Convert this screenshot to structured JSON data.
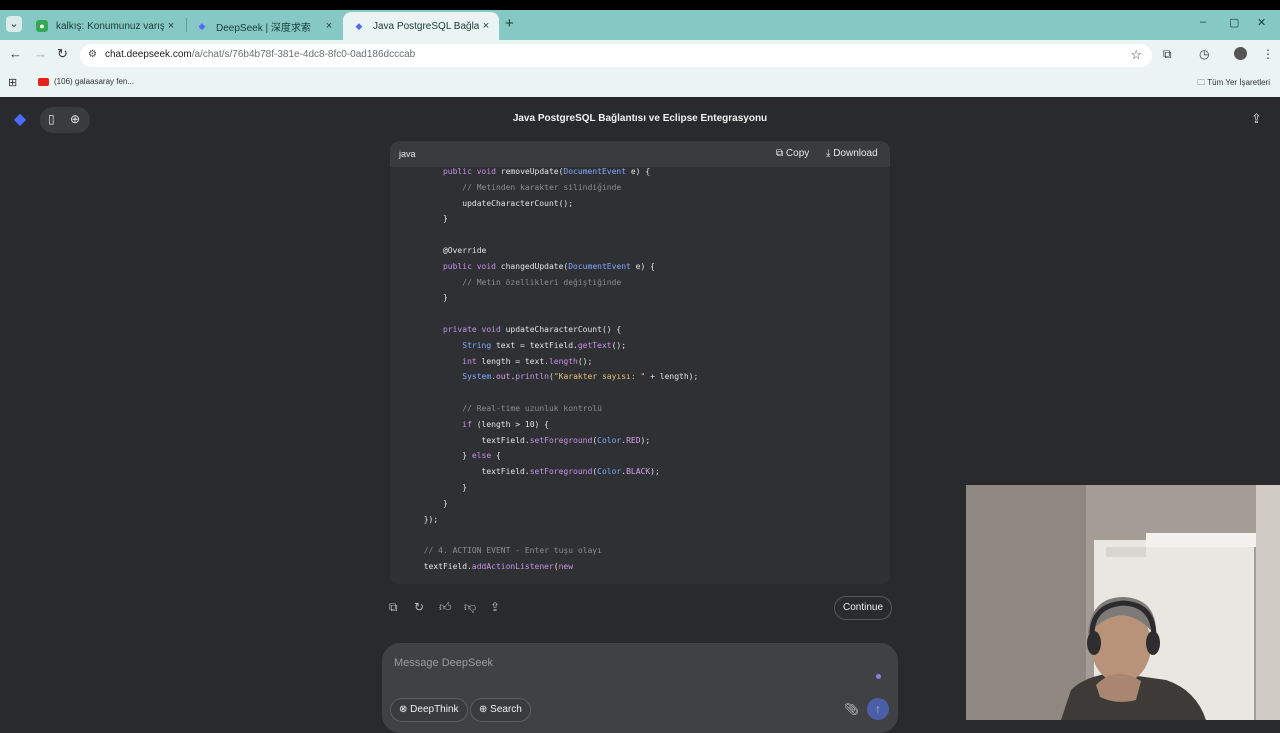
{
  "browser": {
    "tabs": [
      {
        "title": "kalkış: Konumunuz varış: Ayvan",
        "close": "×"
      },
      {
        "title": "DeepSeek | 深度求索",
        "close": "×"
      },
      {
        "title": "Java PostgreSQL Bağlantısı ve E",
        "close": "×"
      }
    ],
    "new_tab": "+",
    "url_host": "chat.deepseek.com",
    "url_path": "/a/chat/s/76b4b78f-381e-4dc8-8fc0-0ad186dcccab",
    "bookmarks": [
      {
        "label": "(106) galaasaray fen..."
      }
    ],
    "bookmarks_all": "Tüm Yer İşaretleri"
  },
  "app": {
    "chat_title": "Java PostgreSQL Bağlantısı ve Eclipse Entegrasyonu",
    "code_block": {
      "language": "java",
      "copy_label": "Copy",
      "download_label": "Download",
      "lines": [
        "        public void removeUpdate(DocumentEvent e) {",
        "            // Metinden karakter silindiğinde",
        "            updateCharacterCount();",
        "        }",
        "",
        "        @Override",
        "        public void changedUpdate(DocumentEvent e) {",
        "            // Metin özellikleri değiştiğinde",
        "        }",
        "",
        "        private void updateCharacterCount() {",
        "            String text = textField.getText();",
        "            int length = text.length();",
        "            System.out.println(\"Karakter sayısı: \" + length);",
        "",
        "            // Real-time uzunluk kontrolü",
        "            if (length > 10) {",
        "                textField.setForeground(Color.RED);",
        "            } else {",
        "                textField.setForeground(Color.BLACK);",
        "            }",
        "        }",
        "    });",
        "",
        "    // 4. ACTION EVENT - Enter tuşu olayı",
        "    textField.addActionListener(new"
      ]
    },
    "continue_label": "Continue",
    "composer": {
      "placeholder": "Message DeepSeek",
      "deepthink_label": "DeepThink",
      "search_label": "Search"
    },
    "colors": {
      "accent": "#4d6bfe",
      "background": "#292a2d",
      "code_bg": "#2f3033"
    }
  }
}
